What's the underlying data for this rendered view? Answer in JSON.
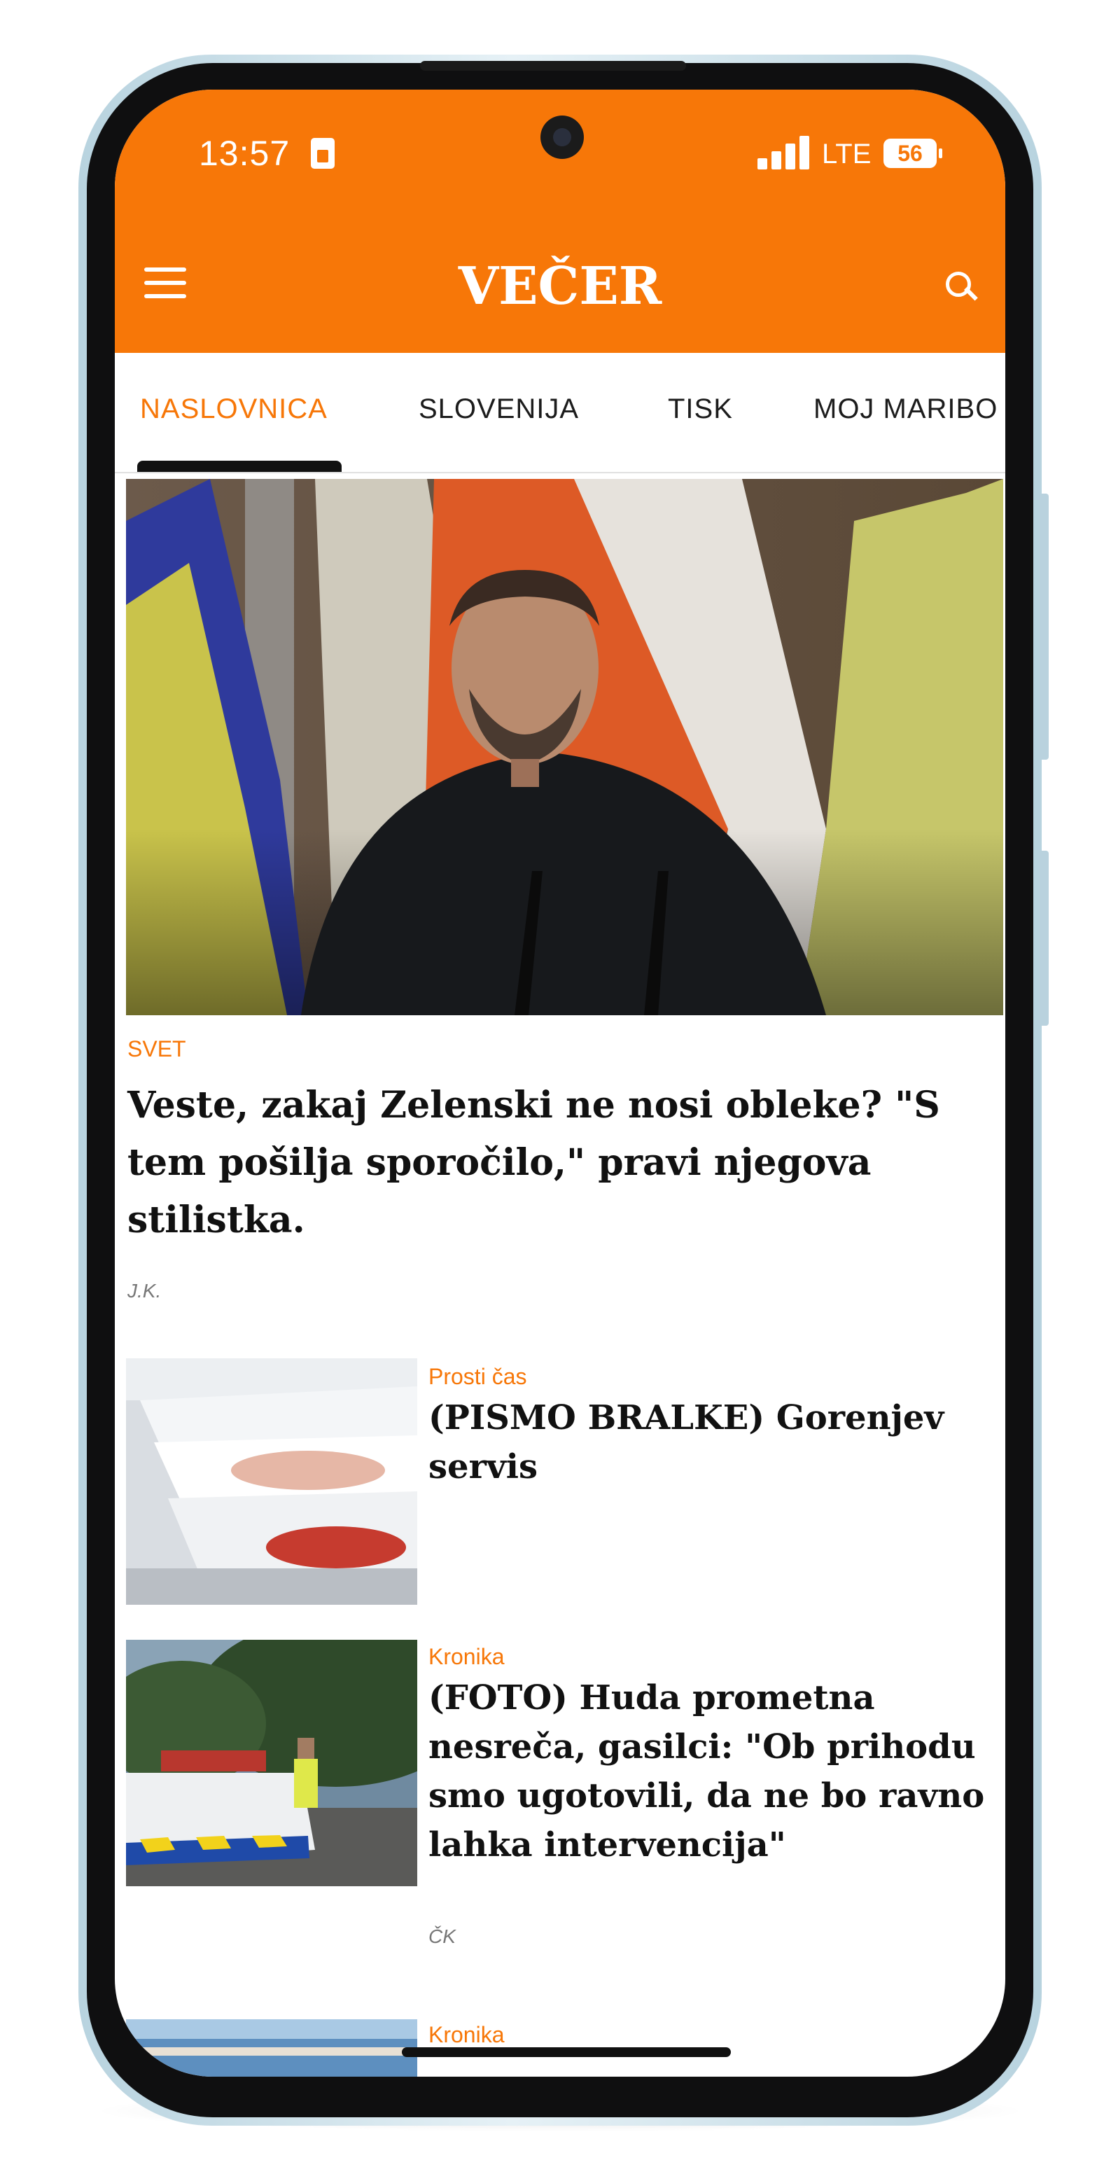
{
  "status_bar": {
    "time": "13:57",
    "network": "LTE",
    "battery": "56",
    "signal_bars": 4
  },
  "app_bar": {
    "brand": "VEČER",
    "menu_icon": "hamburger-menu-icon",
    "search_icon": "search-icon"
  },
  "tabs": [
    {
      "label": "NASLOVNICA",
      "active": true
    },
    {
      "label": "SLOVENIJA",
      "active": false
    },
    {
      "label": "TISK",
      "active": false
    },
    {
      "label": "MOJ MARIBO",
      "active": false
    }
  ],
  "hero": {
    "category": "SVET",
    "headline": "Veste, zakaj Zelenski ne nosi obleke? \"S tem pošilja sporočilo,\" pravi njegova stilistka.",
    "author": "J.K."
  },
  "articles": [
    {
      "category": "Prosti čas",
      "headline": "(PISMO BRALKE) Gorenjev servis",
      "author": ""
    },
    {
      "category": "Kronika",
      "headline": "(FOTO) Huda prometna nesreča, gasilci: \"Ob prihodu smo ugotovili, da ne bo ravno lahka intervencija\"",
      "author": "ČK"
    },
    {
      "category": "Kronika",
      "headline": "",
      "author": ""
    }
  ],
  "colors": {
    "accent": "#f77708",
    "text": "#111111",
    "muted": "#777777"
  }
}
